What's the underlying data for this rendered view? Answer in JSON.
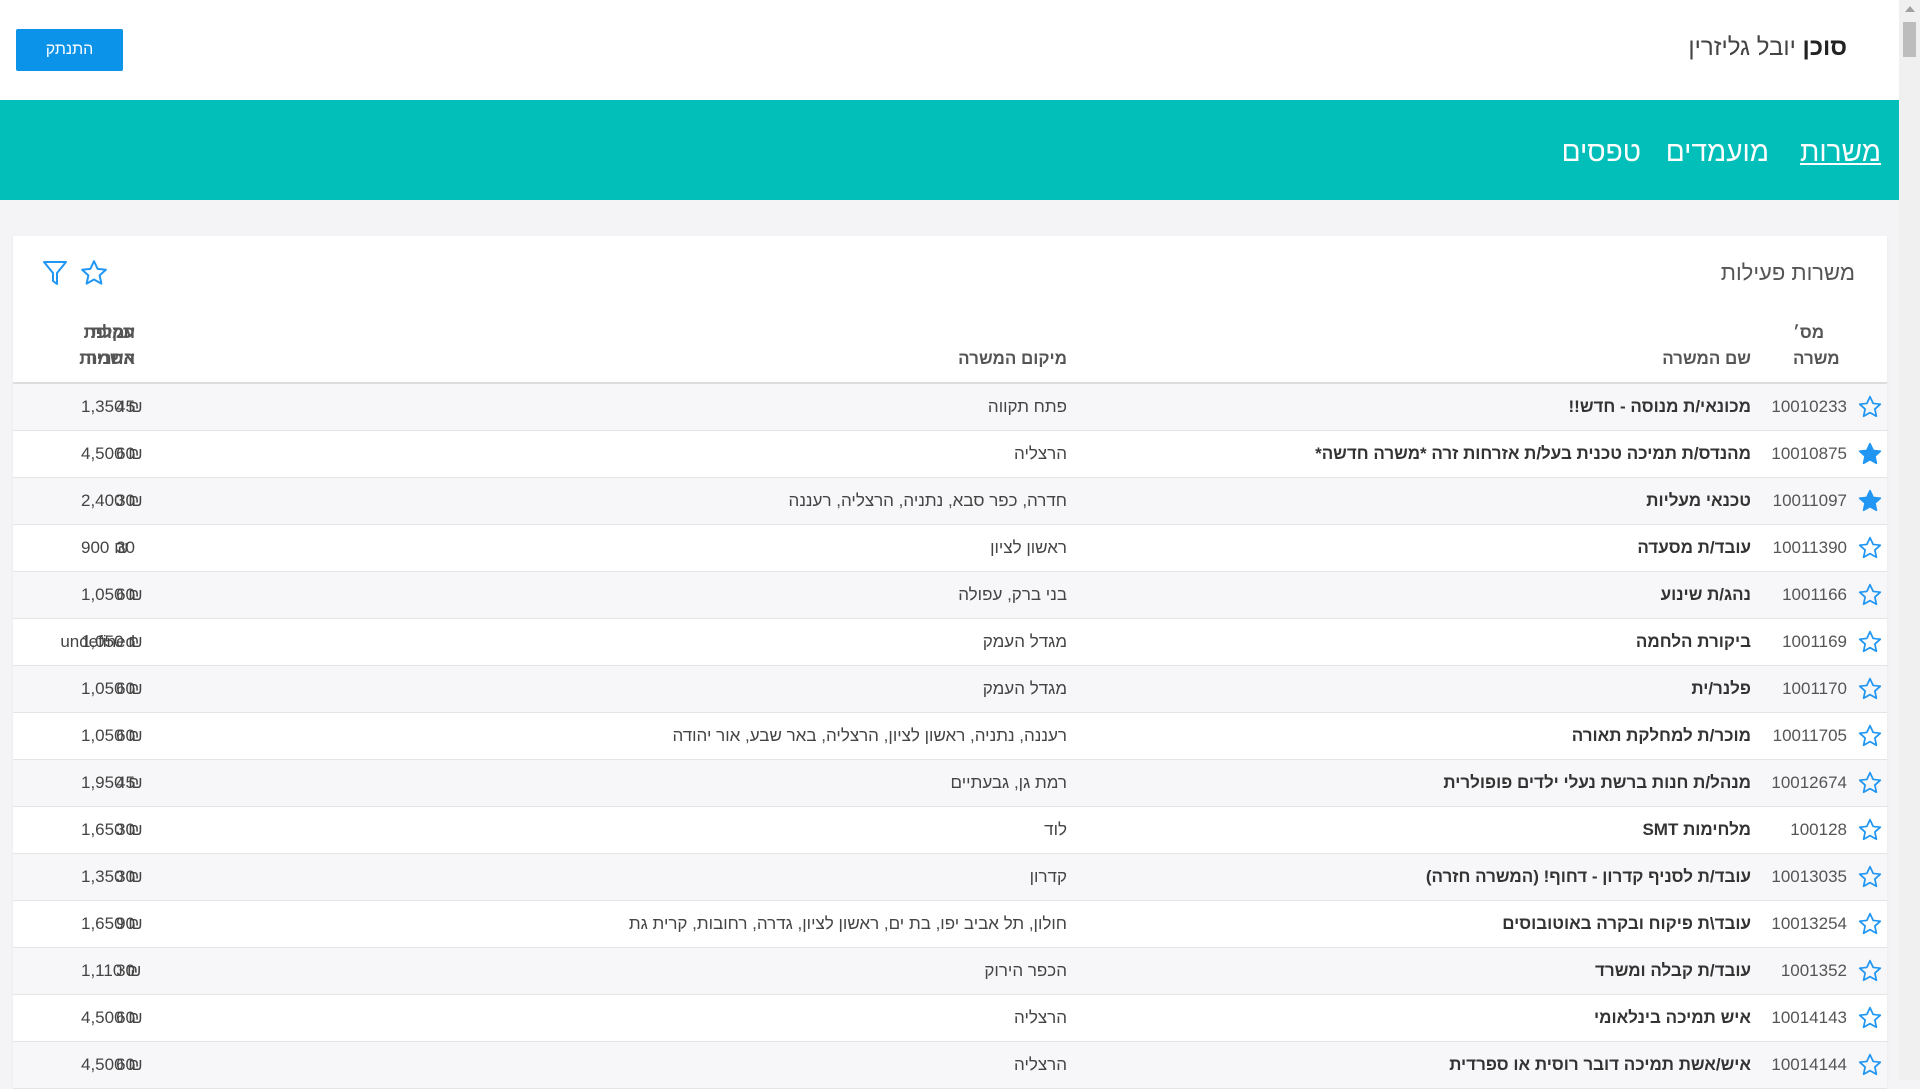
{
  "header": {
    "agent_prefix": "סוכן",
    "agent_name": "יובל גליזרין",
    "logout_label": "התנתק"
  },
  "nav": {
    "items": [
      "משרות",
      "מועמדים",
      "טפסים"
    ],
    "active": "משרות"
  },
  "card": {
    "title": "משרות פעילות"
  },
  "icons": {
    "filter": "funnel-outline-icon",
    "favorites": "star-outline-icon",
    "star_filled_color": "#2196f3",
    "star_outline_color": "#2196f3"
  },
  "colors": {
    "nav_bg": "#02bfb9",
    "button_bg": "#0a93e8",
    "accent": "#2196f3"
  },
  "table": {
    "headers": {
      "num": "מס׳ משרה",
      "name": "שם המשרה",
      "location": "מיקום המשרה",
      "fee": "עמלת השמה",
      "warranty": "תקופת אחריות"
    },
    "rows": [
      {
        "starred": false,
        "num": "10010233",
        "name": "מכונאי/ת מנוסה - חדש!!",
        "location": "פתח תקווה",
        "fee": "1,350 ₪",
        "warranty": "45"
      },
      {
        "starred": true,
        "num": "10010875",
        "name": "מהנדס/ת תמיכה טכנית בעל/ת אזרחות זרה *משרה חדשה*",
        "location": "הרצליה",
        "fee": "4,500 ₪",
        "warranty": "60"
      },
      {
        "starred": true,
        "num": "10011097",
        "name": "טכנאי מעליות",
        "location": "חדרה, כפר סבא, נתניה, הרצליה, רעננה",
        "fee": "2,400 ₪",
        "warranty": "30"
      },
      {
        "starred": false,
        "num": "10011390",
        "name": "עובד/ת מסעדה",
        "location": "ראשון לציון",
        "fee": "900 ₪",
        "warranty": "30"
      },
      {
        "starred": false,
        "num": "1001166",
        "name": "נהג/ת שינוע",
        "location": "בני ברק, עפולה",
        "fee": "1,050 ₪",
        "warranty": "60"
      },
      {
        "starred": false,
        "num": "1001169",
        "name": "ביקורת הלחמה",
        "location": "מגדל העמק",
        "fee": "1,050 ₪",
        "warranty": "undefined"
      },
      {
        "starred": false,
        "num": "1001170",
        "name": "פלנר/ית",
        "location": "מגדל העמק",
        "fee": "1,050 ₪",
        "warranty": "60"
      },
      {
        "starred": false,
        "num": "10011705",
        "name": "מוכר/ת למחלקת תאורה",
        "location": "רעננה, נתניה, ראשון לציון, הרצליה, באר שבע, אור יהודה",
        "fee": "1,050 ₪",
        "warranty": "60"
      },
      {
        "starred": false,
        "num": "10012674",
        "name": "מנהל/ת חנות ברשת נעלי ילדים פופולרית",
        "location": "רמת גן, גבעתיים",
        "fee": "1,950 ₪",
        "warranty": "45"
      },
      {
        "starred": false,
        "num": "100128",
        "name": "מלחימות SMT",
        "location": "לוד",
        "fee": "1,650 ₪",
        "warranty": "30"
      },
      {
        "starred": false,
        "num": "10013035",
        "name": "עובד/ת לסניף קדרון - דחוף! (המשרה חזרה)",
        "location": "קדרון",
        "fee": "1,350 ₪",
        "warranty": "30"
      },
      {
        "starred": false,
        "num": "10013254",
        "name": "עובד\\ת פיקוח ובקרה באוטובוסים",
        "location": "חולון, תל אביב יפו, בת ים, ראשון לציון, גדרה, רחובות, קרית גת",
        "fee": "1,650 ₪",
        "warranty": "90"
      },
      {
        "starred": false,
        "num": "1001352",
        "name": "עובד/ת קבלה ומשרד",
        "location": "הכפר הירוק",
        "fee": "1,110 ₪",
        "warranty": "30"
      },
      {
        "starred": false,
        "num": "10014143",
        "name": "איש תמיכה בינלאומי",
        "location": "הרצליה",
        "fee": "4,500 ₪",
        "warranty": "60"
      },
      {
        "starred": false,
        "num": "10014144",
        "name": "איש/אשת תמיכה דובר רוסית או ספרדית",
        "location": "הרצליה",
        "fee": "4,500 ₪",
        "warranty": "60"
      }
    ]
  }
}
